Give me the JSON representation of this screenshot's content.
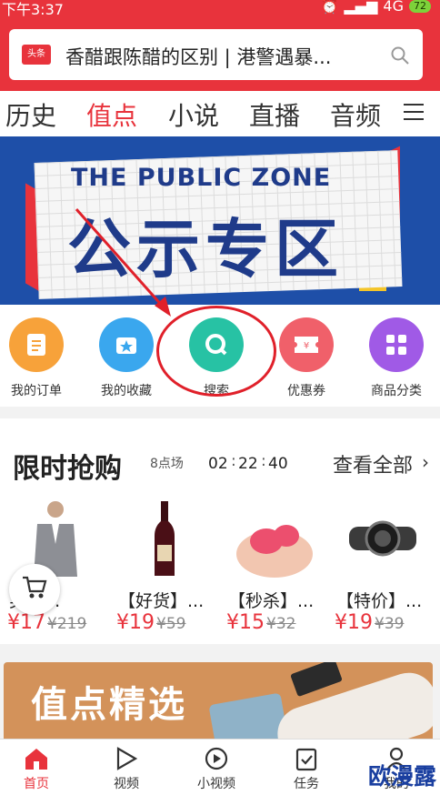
{
  "status": {
    "time": "下午3:37",
    "network": "4G",
    "battery": "72"
  },
  "search": {
    "tag": "头条",
    "text": "香醋跟陈醋的区别 | 港警遇暴..."
  },
  "tabs": [
    "历史",
    "值点",
    "小说",
    "直播",
    "音频"
  ],
  "banner": {
    "en_title": "THE PUBLIC ZONE",
    "cn_title": "公示专区"
  },
  "quick": [
    {
      "label": "我的订单",
      "icon": "order-icon",
      "color": "#f7a23a"
    },
    {
      "label": "我的收藏",
      "icon": "favorite-box-icon",
      "color": "#3aa7ee"
    },
    {
      "label": "搜索",
      "icon": "search-icon",
      "color": "#27c2a4"
    },
    {
      "label": "优惠券",
      "icon": "coupon-icon",
      "color": "#f0606a"
    },
    {
      "label": "商品分类",
      "icon": "category-grid-icon",
      "color": "#a05ae6"
    }
  ],
  "flash": {
    "title": "限时抢购",
    "session": "8点场",
    "countdown": {
      "h": "02",
      "m": "22",
      "s": "40"
    },
    "view_all": "查看全部"
  },
  "products": [
    {
      "name": "男士...",
      "price": "¥17",
      "old": "¥219",
      "icon": "suit-man-icon"
    },
    {
      "name": "【好货】...",
      "price": "¥19",
      "old": "¥59",
      "icon": "wine-bottle-icon"
    },
    {
      "name": "【秒杀】...",
      "price": "¥15",
      "old": "¥32",
      "icon": "massager-icon"
    },
    {
      "name": "【特价】...",
      "price": "¥19",
      "old": "¥39",
      "icon": "watch-icon"
    }
  ],
  "picks": {
    "title": "值点精选"
  },
  "nav": [
    {
      "label": "首页",
      "icon": "home-icon"
    },
    {
      "label": "视频",
      "icon": "video-play-icon"
    },
    {
      "label": "小视频",
      "icon": "small-video-icon"
    },
    {
      "label": "任务",
      "icon": "task-icon"
    },
    {
      "label": "我的",
      "icon": "profile-icon"
    }
  ],
  "watermark": "欧漫露",
  "colors": {
    "brand_red": "#e8333c",
    "banner_blue": "#1e4fa8"
  }
}
